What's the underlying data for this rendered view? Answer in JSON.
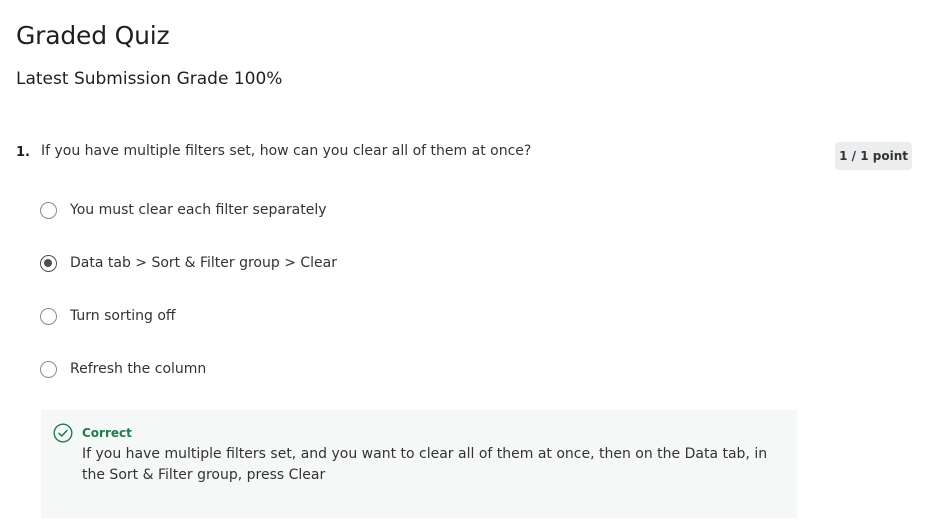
{
  "quiz": {
    "title": "Graded Quiz",
    "latest_grade": "Latest Submission Grade 100%"
  },
  "question": {
    "number": "1.",
    "text": "If you have multiple filters set, how can you clear all of them at once?",
    "points": "1 / 1 point",
    "options": [
      {
        "label": "You must clear each filter separately",
        "selected": false
      },
      {
        "label": "Data tab > Sort & Filter group > Clear",
        "selected": true
      },
      {
        "label": "Turn sorting off",
        "selected": false
      },
      {
        "label": "Refresh the column",
        "selected": false
      }
    ]
  },
  "feedback": {
    "status": "Correct",
    "icon": "check-circle-icon",
    "text": "If you have multiple filters set, and you want to clear all of them at once, then on the Data tab, in the Sort & Filter group, press Clear",
    "color": "#1e7d4b"
  }
}
